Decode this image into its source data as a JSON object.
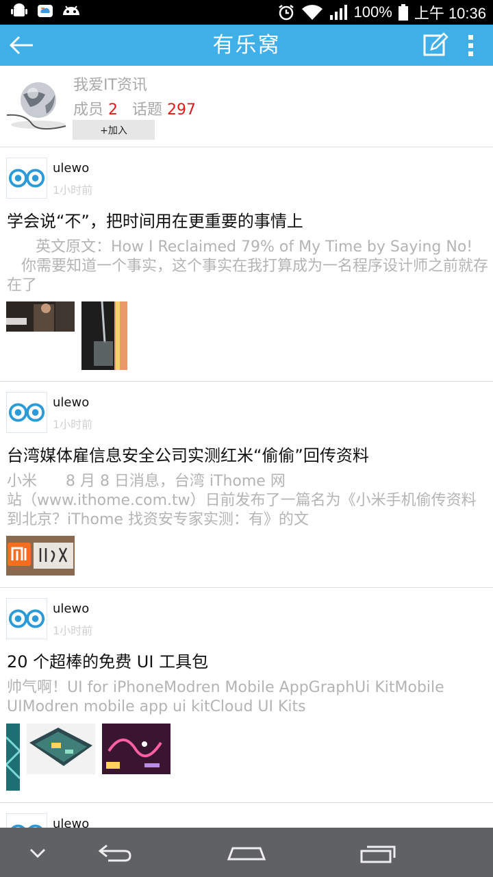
{
  "status_bar": {
    "battery": "100%",
    "time": "上午 10:36",
    "icons": [
      "android-icon",
      "cloud-app-icon",
      "android-head-icon",
      "alarm-icon",
      "wifi-icon",
      "signal-icon",
      "battery-icon"
    ]
  },
  "header": {
    "title": "有乐窝",
    "back_icon": "back-arrow-icon",
    "edit_icon": "edit-icon",
    "more_icon": "overflow-menu-icon"
  },
  "group": {
    "name": "我爱IT资讯",
    "members_label": "成员",
    "members_count": "2",
    "topics_label": "话题",
    "topics_count": "297",
    "join_label": "+加入"
  },
  "posts": [
    {
      "user": "ulewo",
      "time": "1小时前",
      "title": "学会说“不”，把时间用在更重要的事情上",
      "body": "      英文原文：How I Reclaimed 79% of My Time by Saying No!\n   你需要知道一个事实，这个事实在我打算成为一名程序设计师之前就存在了"
    },
    {
      "user": "ulewo",
      "time": "1小时前",
      "title": "台湾媒体雇信息安全公司实测红米“偷偷”回传资料",
      "body": "小米      8 月 8 日消息，台湾 iThome 网\n站（www.ithome.com.tw）日前发布了一篇名为《小米手机偷传资料到北京？iThome 找资安专家实测：有》的文"
    },
    {
      "user": "ulewo",
      "time": "1小时前",
      "title": "20 个超棒的免费 UI 工具包",
      "body": "帅气啊！UI for iPhoneModren Mobile AppGraphUi KitMobile UIModren mobile app ui kitCloud UI Kits"
    },
    {
      "user": "ulewo"
    }
  ],
  "nav": {
    "icons": [
      "hide-keyboard-icon",
      "back-nav-icon",
      "home-nav-icon",
      "recents-nav-icon"
    ]
  },
  "colors": {
    "accent": "#40aee7",
    "count_red": "#e01a1a",
    "muted_text": "#b4b4b4",
    "navbar": "#5f6164"
  }
}
